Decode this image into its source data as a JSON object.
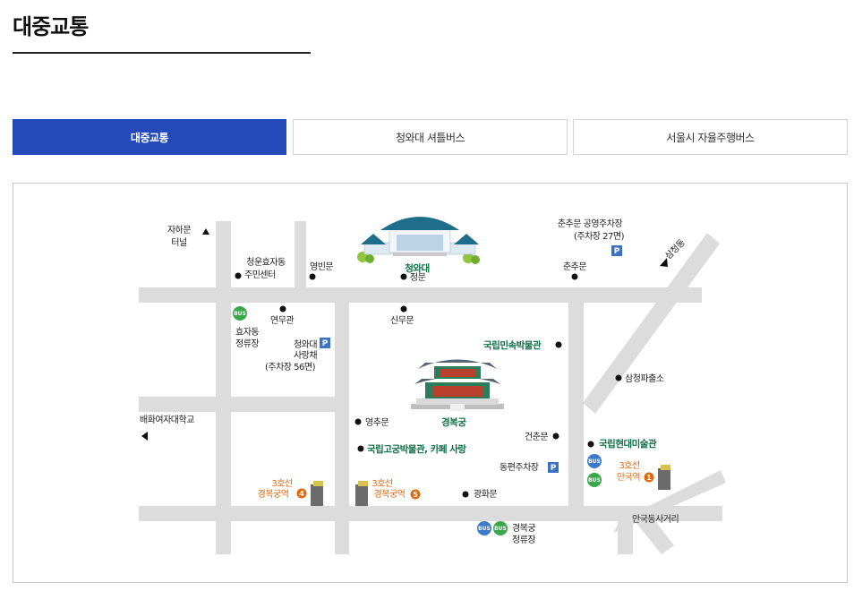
{
  "page": {
    "title": "대중교통"
  },
  "tabs": [
    {
      "label": "대중교통",
      "active": true
    },
    {
      "label": "청와대 셔틀버스",
      "active": false
    },
    {
      "label": "서울시 자율주행버스",
      "active": false
    }
  ],
  "map": {
    "landmarks": {
      "cheongwadae": "청와대",
      "gyeongbokgung": "경복궁",
      "folk_museum": "국립민속박물관",
      "palace_museum": "국립고궁박물관, 카페 사랑",
      "mmca": "국립현대미술관"
    },
    "places": {
      "jaha_tunnel_1": "자하문",
      "jaha_tunnel_2": "터널",
      "community_1": "청운효자동",
      "community_2": "주민센터",
      "yeongbinmun": "영빈문",
      "jeongmun": "정문",
      "chunchu_parking_1": "춘추문 공영주차장",
      "chunchu_parking_2": "(주차장 27면)",
      "chunchumun": "춘추문",
      "samcheong": "삼청동",
      "yeonmugwan": "연무관",
      "sinmumun": "신무문",
      "hyoja_stop_1": "효자동",
      "hyoja_stop_2": "정류장",
      "sarangchae_1": "청와대",
      "sarangchae_2": "사랑채",
      "sarangchae_3": "(주차장 56면)",
      "police_box": "삼청파출소",
      "baehwa_school": "배화여자대학교",
      "yeongchumun": "영추문",
      "geonchunmun": "건춘문",
      "east_parking": "동편주차장",
      "gwanghwamun": "광화문",
      "anguk_junction": "안국동사거리",
      "gb_stop_1": "경복궁",
      "gb_stop_2": "정류장"
    },
    "stations": {
      "gyeongbokgung_4_line": "3호선",
      "gyeongbokgung_4_name": "경복궁역",
      "gyeongbokgung_4_exit": "4",
      "gyeongbokgung_5_line": "3호선",
      "gyeongbokgung_5_name": "경복궁역",
      "gyeongbokgung_5_exit": "5",
      "anguk_1_line": "3호선",
      "anguk_1_name": "안국역",
      "anguk_1_exit": "1"
    },
    "badges": {
      "bus": "BUS",
      "parking": "P"
    },
    "icons": [
      "bus-icon",
      "parking-icon",
      "subway-exit-icon",
      "arrow-icon",
      "location-dot-icon"
    ],
    "colors": {
      "accent_blue": "#2449b8",
      "landmark_green": "#0f6f45",
      "subway_orange": "#e06a10",
      "bus_green": "#3aa84a",
      "bus_blue": "#3b7ac8",
      "parking_blue": "#3b72c2",
      "road_gray": "#dcdcdc"
    }
  }
}
